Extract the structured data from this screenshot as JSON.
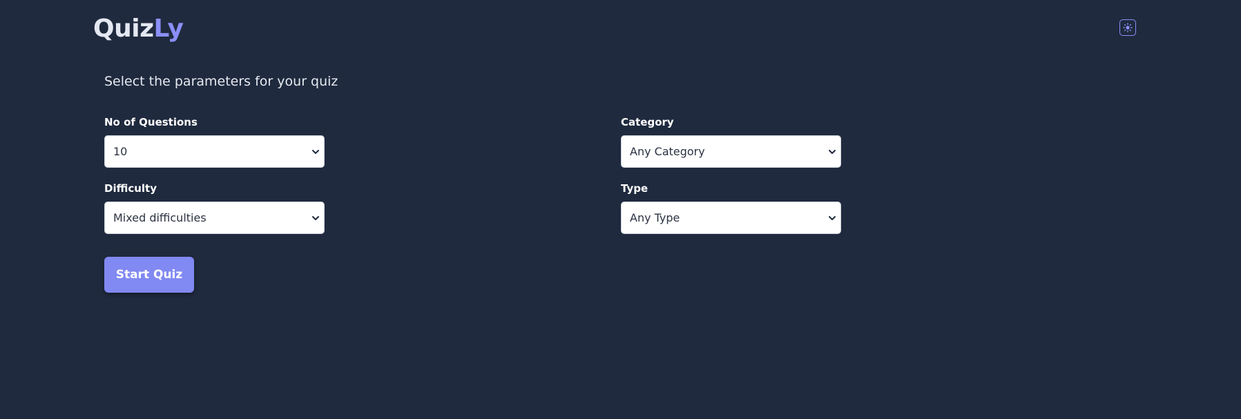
{
  "header": {
    "logo_part1": "Quiz",
    "logo_part2": "Ly",
    "theme_toggle_icon": "sun-icon"
  },
  "form": {
    "subtitle": "Select the parameters for your quiz",
    "questions": {
      "label": "No of Questions",
      "value": "10"
    },
    "category": {
      "label": "Category",
      "value": "Any Category"
    },
    "difficulty": {
      "label": "Difficulty",
      "value": "Mixed difficulties"
    },
    "type": {
      "label": "Type",
      "value": "Any Type"
    },
    "start_label": "Start Quiz"
  },
  "colors": {
    "background": "#1f2a3e",
    "accent": "#8b8ff8",
    "button": "#8189f2"
  }
}
